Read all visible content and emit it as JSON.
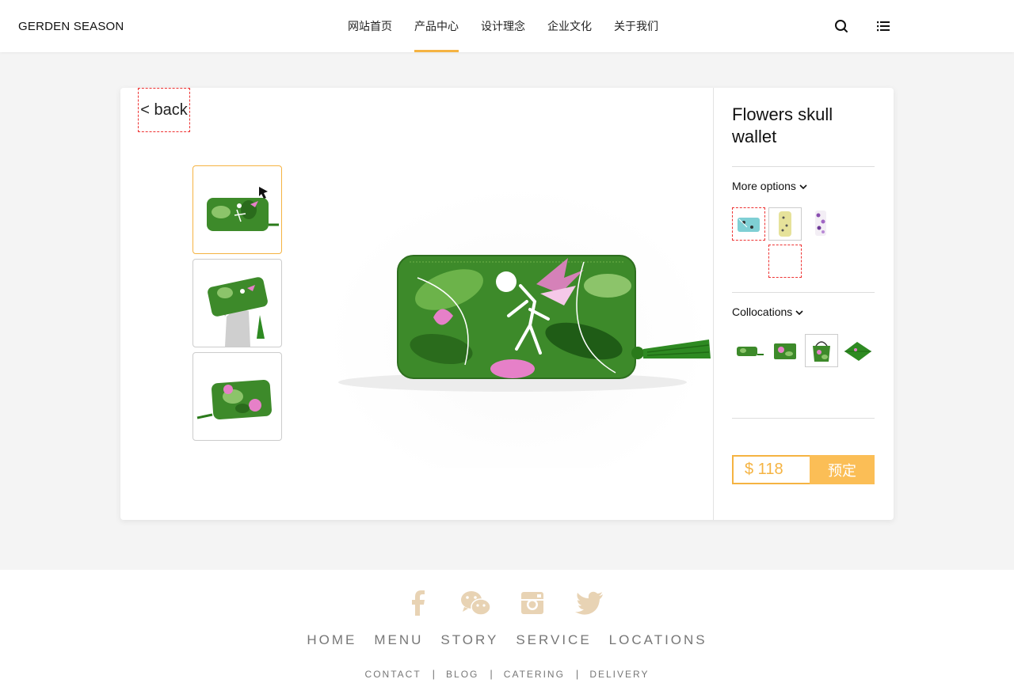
{
  "header": {
    "brand": "GERDEN SEASON",
    "nav": [
      "网站首页",
      "产品中心",
      "设计理念",
      "企业文化",
      "关于我们"
    ],
    "active_nav": "产品中心"
  },
  "product": {
    "back_label": "< back",
    "title": "Flowers skull wallet",
    "more_options_label": "More options",
    "collocations_label": "Collocations",
    "price": "$ 118",
    "reserve_label": "预定"
  },
  "footer": {
    "menu": [
      "HOME",
      "MENU",
      "STORY",
      "SERVICE",
      "LOCATIONS"
    ],
    "sub": [
      "CONTACT",
      "BLOG",
      "CATERING",
      "DELIVERY"
    ],
    "separator": "|"
  },
  "colors": {
    "accent": "#f5b342",
    "social": "#e8d3b4",
    "wallet_green": "#3d8a2a"
  },
  "icons": [
    "search-icon",
    "list-menu-icon",
    "facebook-icon",
    "wechat-icon",
    "instagram-icon",
    "twitter-icon",
    "chevron-down-icon",
    "cursor-arrow-icon"
  ]
}
